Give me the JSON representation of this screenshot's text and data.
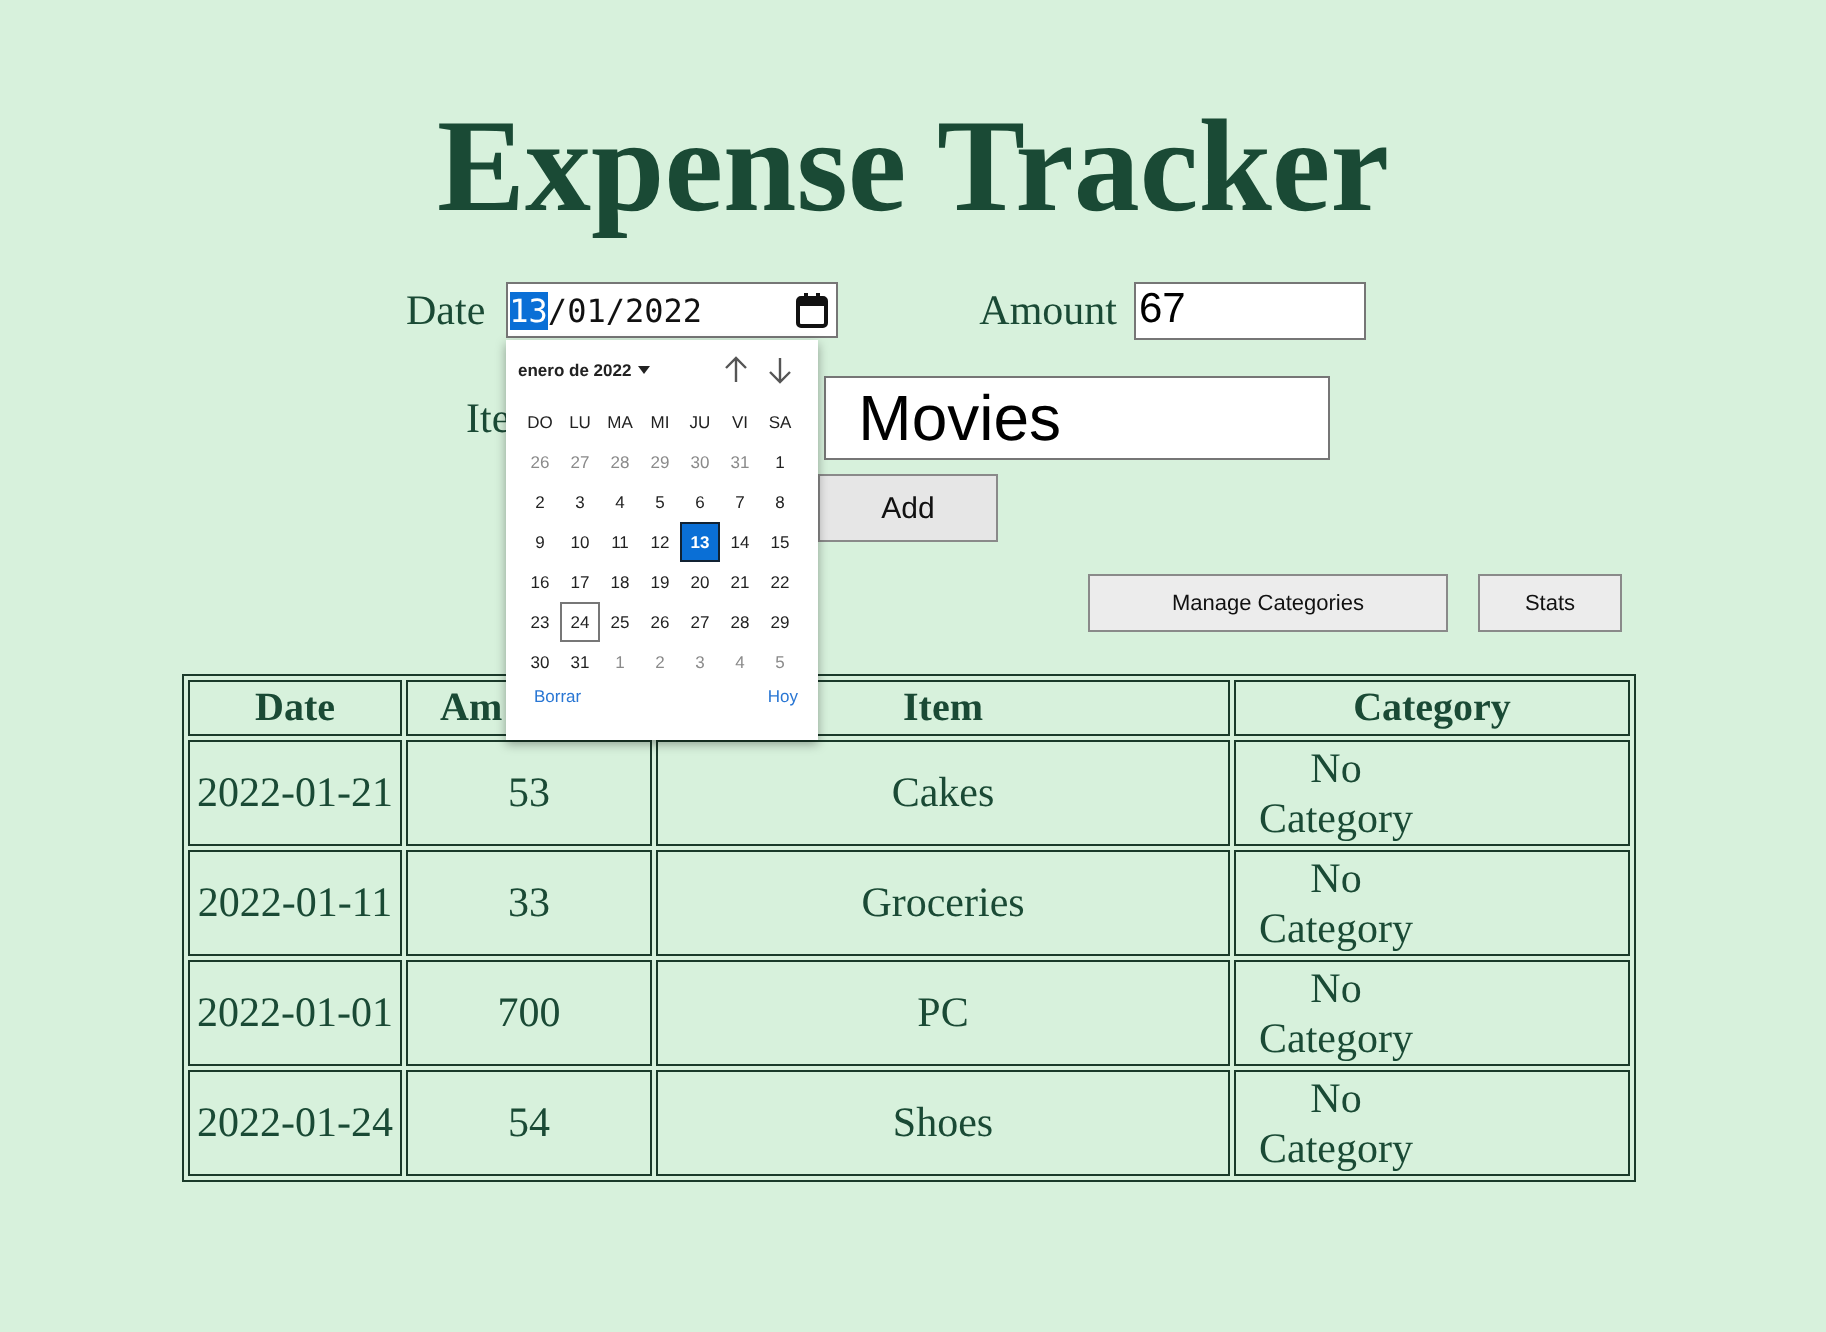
{
  "title": "Expense Tracker",
  "form": {
    "date_label": "Date",
    "date_field": {
      "separator": "/",
      "segments": [
        {
          "text": "13",
          "selected": true
        },
        {
          "text": "01",
          "selected": false
        },
        {
          "text": "2022",
          "selected": false
        }
      ]
    },
    "amount_label": "Amount",
    "amount_value": "67",
    "item_label": "Ite",
    "item_value": "Movies",
    "add_button": "Add"
  },
  "actions": [
    "Manage Categories",
    "Stats"
  ],
  "calendar": {
    "month_label": "enero de 2022",
    "weekdays": [
      "DO",
      "LU",
      "MA",
      "MI",
      "JU",
      "VI",
      "SA"
    ],
    "days": [
      {
        "label": "26",
        "in_month": false,
        "selected": false,
        "today": false
      },
      {
        "label": "27",
        "in_month": false,
        "selected": false,
        "today": false
      },
      {
        "label": "28",
        "in_month": false,
        "selected": false,
        "today": false
      },
      {
        "label": "29",
        "in_month": false,
        "selected": false,
        "today": false
      },
      {
        "label": "30",
        "in_month": false,
        "selected": false,
        "today": false
      },
      {
        "label": "31",
        "in_month": false,
        "selected": false,
        "today": false
      },
      {
        "label": "1",
        "in_month": true,
        "selected": false,
        "today": false
      },
      {
        "label": "2",
        "in_month": true,
        "selected": false,
        "today": false
      },
      {
        "label": "3",
        "in_month": true,
        "selected": false,
        "today": false
      },
      {
        "label": "4",
        "in_month": true,
        "selected": false,
        "today": false
      },
      {
        "label": "5",
        "in_month": true,
        "selected": false,
        "today": false
      },
      {
        "label": "6",
        "in_month": true,
        "selected": false,
        "today": false
      },
      {
        "label": "7",
        "in_month": true,
        "selected": false,
        "today": false
      },
      {
        "label": "8",
        "in_month": true,
        "selected": false,
        "today": false
      },
      {
        "label": "9",
        "in_month": true,
        "selected": false,
        "today": false
      },
      {
        "label": "10",
        "in_month": true,
        "selected": false,
        "today": false
      },
      {
        "label": "11",
        "in_month": true,
        "selected": false,
        "today": false
      },
      {
        "label": "12",
        "in_month": true,
        "selected": false,
        "today": false
      },
      {
        "label": "13",
        "in_month": true,
        "selected": true,
        "today": false
      },
      {
        "label": "14",
        "in_month": true,
        "selected": false,
        "today": false
      },
      {
        "label": "15",
        "in_month": true,
        "selected": false,
        "today": false
      },
      {
        "label": "16",
        "in_month": true,
        "selected": false,
        "today": false
      },
      {
        "label": "17",
        "in_month": true,
        "selected": false,
        "today": false
      },
      {
        "label": "18",
        "in_month": true,
        "selected": false,
        "today": false
      },
      {
        "label": "19",
        "in_month": true,
        "selected": false,
        "today": false
      },
      {
        "label": "20",
        "in_month": true,
        "selected": false,
        "today": false
      },
      {
        "label": "21",
        "in_month": true,
        "selected": false,
        "today": false
      },
      {
        "label": "22",
        "in_month": true,
        "selected": false,
        "today": false
      },
      {
        "label": "23",
        "in_month": true,
        "selected": false,
        "today": false
      },
      {
        "label": "24",
        "in_month": true,
        "selected": false,
        "today": true
      },
      {
        "label": "25",
        "in_month": true,
        "selected": false,
        "today": false
      },
      {
        "label": "26",
        "in_month": true,
        "selected": false,
        "today": false
      },
      {
        "label": "27",
        "in_month": true,
        "selected": false,
        "today": false
      },
      {
        "label": "28",
        "in_month": true,
        "selected": false,
        "today": false
      },
      {
        "label": "29",
        "in_month": true,
        "selected": false,
        "today": false
      },
      {
        "label": "30",
        "in_month": true,
        "selected": false,
        "today": false
      },
      {
        "label": "31",
        "in_month": true,
        "selected": false,
        "today": false
      },
      {
        "label": "1",
        "in_month": false,
        "selected": false,
        "today": false
      },
      {
        "label": "2",
        "in_month": false,
        "selected": false,
        "today": false
      },
      {
        "label": "3",
        "in_month": false,
        "selected": false,
        "today": false
      },
      {
        "label": "4",
        "in_month": false,
        "selected": false,
        "today": false
      },
      {
        "label": "5",
        "in_month": false,
        "selected": false,
        "today": false
      }
    ],
    "clear_link": "Borrar",
    "today_link": "Hoy"
  },
  "table": {
    "columns": [
      "Date",
      "Am",
      "Item",
      "Category"
    ],
    "rows": [
      [
        "2022-01-21",
        "53",
        "Cakes",
        "No Category"
      ],
      [
        "2022-01-11",
        "33",
        "Groceries",
        "No Category"
      ],
      [
        "2022-01-01",
        "700",
        "PC",
        "No Category"
      ],
      [
        "2022-01-24",
        "54",
        "Shoes",
        "No Category"
      ]
    ]
  }
}
